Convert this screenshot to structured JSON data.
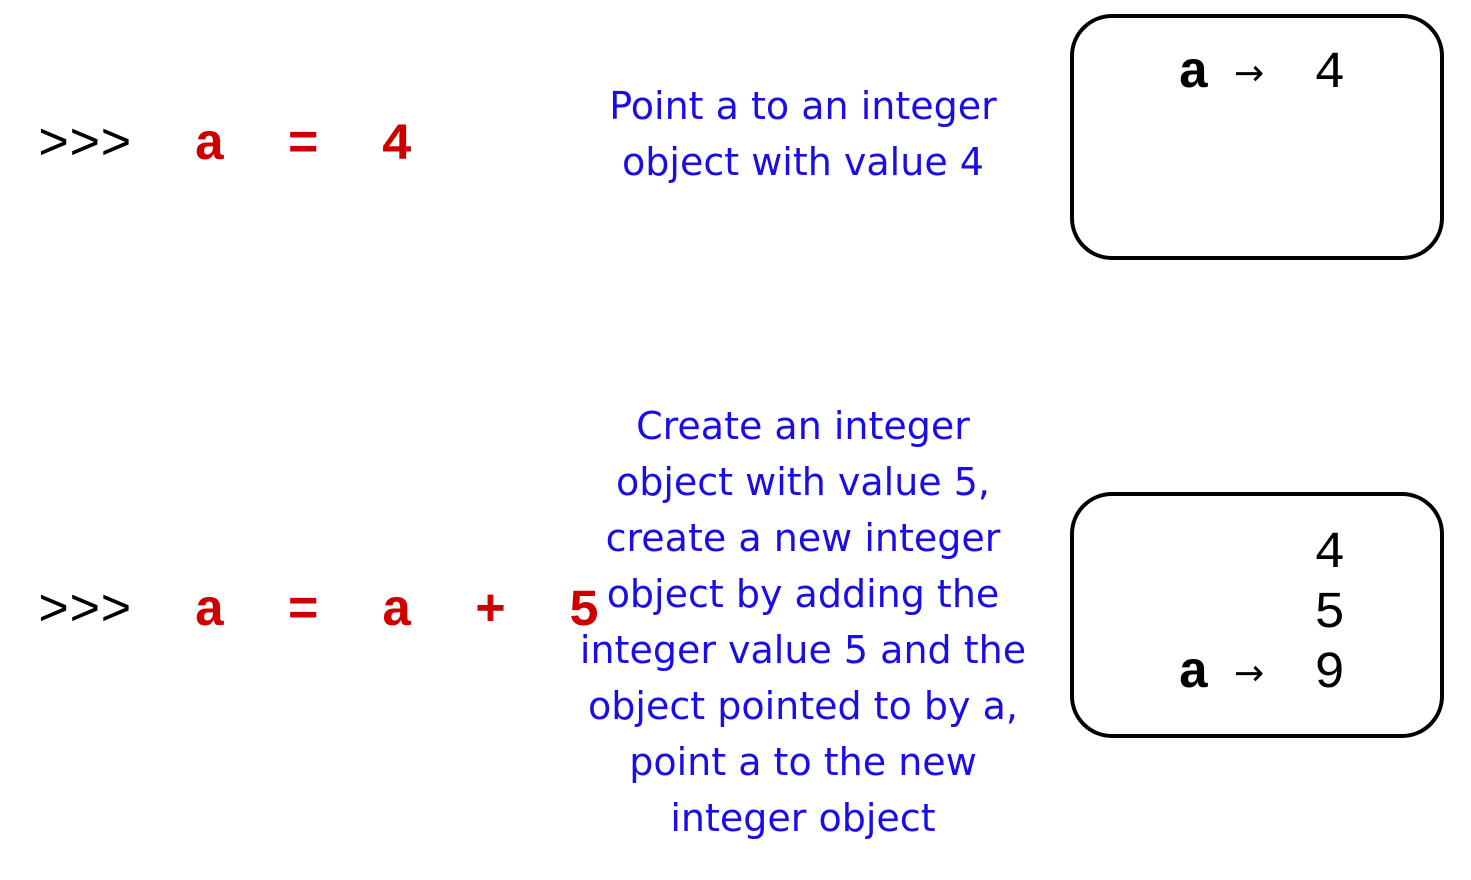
{
  "steps": [
    {
      "prompt": ">>>",
      "code": "a = 4",
      "description_lines": [
        "Point a to an integer",
        "object with value 4"
      ],
      "memory": [
        {
          "var": "a",
          "arrow": "→",
          "value": "4"
        }
      ]
    },
    {
      "prompt": ">>>",
      "code": "a = a + 5",
      "description_lines": [
        "Create an integer",
        "object with value 5,",
        "create a new integer",
        "object by adding the",
        "integer value 5 and the",
        "object pointed to by a,",
        "point a to the new",
        "integer object"
      ],
      "memory": [
        {
          "var": "",
          "arrow": "",
          "value": "4"
        },
        {
          "var": "",
          "arrow": "",
          "value": "5"
        },
        {
          "var": "a",
          "arrow": "→",
          "value": "9"
        }
      ]
    }
  ],
  "colors": {
    "code": "#cc0000",
    "description": "#1a0de6",
    "prompt": "#000000",
    "box_border": "#000000"
  }
}
